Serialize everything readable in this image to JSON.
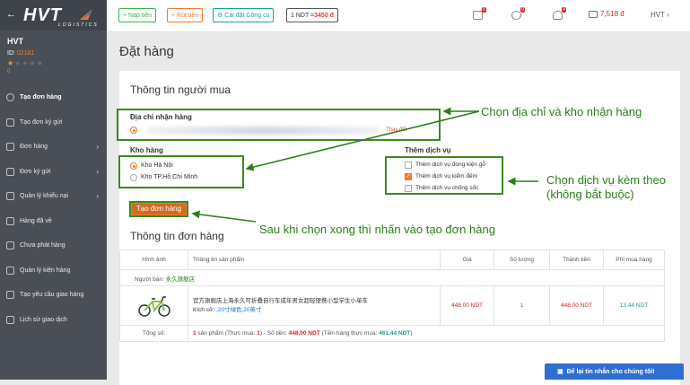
{
  "sidebar": {
    "logo_text": "HVT",
    "logo_sub": "LOGISTICS",
    "username": "HVT",
    "id_label": "ID:",
    "id_value": "02181",
    "points": "0",
    "items": [
      {
        "label": "Tạo đơn hàng",
        "active": true
      },
      {
        "label": "Tạo đơn ký gửi"
      },
      {
        "label": "Đơn hàng",
        "chevron": "›"
      },
      {
        "label": "Đơn ký gửi",
        "chevron": "›"
      },
      {
        "label": "Quản lý khiếu nại",
        "chevron": "›"
      },
      {
        "label": "Hàng đã về"
      },
      {
        "label": "Chưa phát hàng"
      },
      {
        "label": "Quản lý kiện hàng"
      },
      {
        "label": "Tạo yêu cầu giao hàng"
      },
      {
        "label": "Lịch sử giao dịch"
      }
    ]
  },
  "topbar": {
    "nap_tien": "+ Nạp tiền",
    "rut_tien": "+ Rút tiền",
    "cai_dat": "Cài đặt Công cụ",
    "rate_prefix": "1 NDT = ",
    "rate_value": "3450 đ",
    "cart_badge": "6",
    "gear_badge": "0",
    "bell_badge": "4",
    "wallet": "7,518 đ",
    "user": "HVT"
  },
  "page": {
    "title": "Đặt hàng",
    "buyer_title": "Thông tin người mua",
    "address_label": "Địa chỉ nhận hàng",
    "change": "Thay đổi",
    "warehouse_label": "Kho hàng",
    "warehouses": [
      "Kho Hà Nội",
      "Kho TP.Hồ Chí Minh"
    ],
    "services_label": "Thêm dịch vụ",
    "services": [
      "Thêm dịch vụ đóng kiện gỗ",
      "Thêm dịch vụ kiểm đếm",
      "Thêm dịch vụ chống sốc"
    ],
    "order_button": "Tạo đơn hàng",
    "order_title": "Thông tin đơn hàng"
  },
  "annotations": {
    "address": "Chọn địa chỉ và kho nhận hàng",
    "services_line1": "Chọn dịch vụ kèm theo",
    "services_line2": "(không bắt buộc)",
    "button": "Sau khi chọn xong thì nhấn vào tạo đơn hàng"
  },
  "table": {
    "headers": [
      "Hình ảnh",
      "Thông tin sản phẩm",
      "Giá",
      "Số lượng",
      "Thành tiền",
      "Phí mua hàng"
    ],
    "seller_prefix": "Người bán: ",
    "seller": "永久旗舰店",
    "product_name": "官方旗舰店上海永久可折叠自行车成年男女超轻便携小型学生小单车",
    "size_label": "Kích cỡ: ",
    "size_value": ";20寸绿色;20英寸",
    "price": "448.00 NDT",
    "qty": "1",
    "subtotal": "448.00 NDT",
    "fee": "13.44 NDT",
    "total_label": "Tổng số:",
    "total_count": "1",
    "total_mid1": " sản phẩm (Thực mua: ",
    "total_real": "1",
    "total_mid2": ") - Số tiền: ",
    "total_amount": "448.00 NDT",
    "total_mid3": " (Tiền hàng thực mua: ",
    "total_real_amount": "461.44 NDT",
    "total_end": ")"
  },
  "chat": "Để lại tin nhắn cho chúng tôi!"
}
